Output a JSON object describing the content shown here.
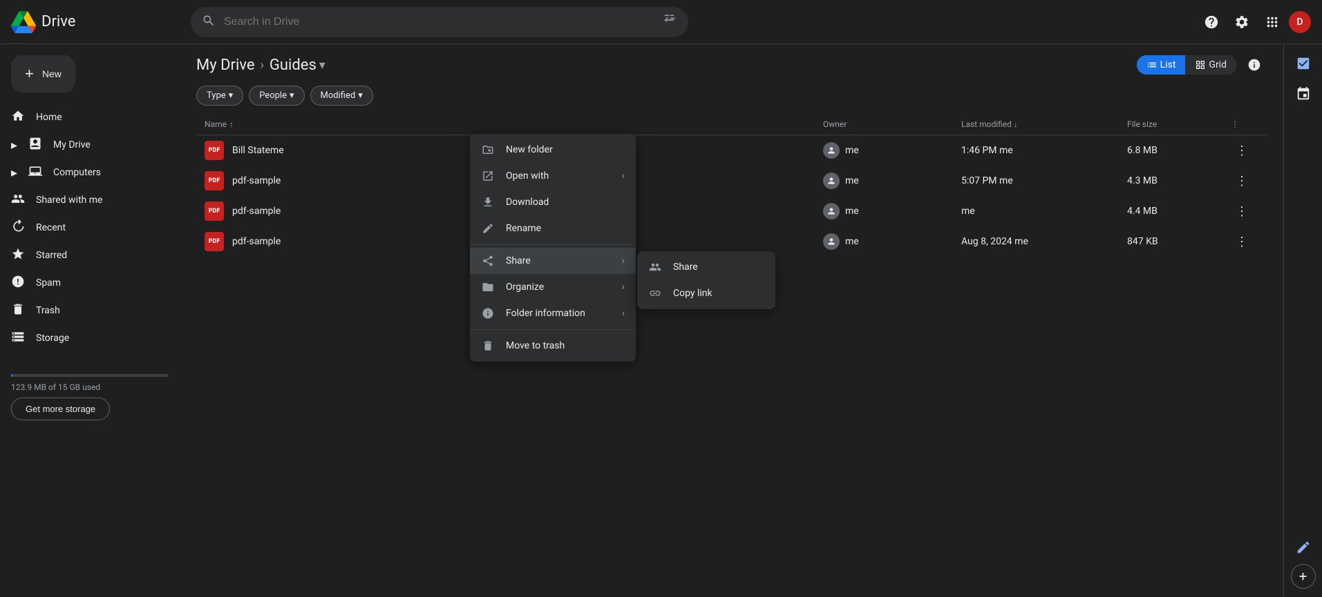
{
  "app": {
    "name": "Drive",
    "logo_alt": "Google Drive"
  },
  "topbar": {
    "search_placeholder": "Search in Drive",
    "help_icon": "?",
    "settings_icon": "⚙",
    "apps_icon": "⠿",
    "avatar_initial": "D"
  },
  "sidebar": {
    "new_button_label": "New",
    "items": [
      {
        "id": "home",
        "label": "Home",
        "icon": "🏠",
        "active": false
      },
      {
        "id": "my-drive",
        "label": "My Drive",
        "icon": "📁",
        "active": false,
        "expandable": true
      },
      {
        "id": "computers",
        "label": "Computers",
        "icon": "💻",
        "active": false,
        "expandable": true
      },
      {
        "id": "shared-with-me",
        "label": "Shared with me",
        "icon": "👥",
        "active": false
      },
      {
        "id": "recent",
        "label": "Recent",
        "icon": "🕐",
        "active": false
      },
      {
        "id": "starred",
        "label": "Starred",
        "icon": "⭐",
        "active": false
      },
      {
        "id": "spam",
        "label": "Spam",
        "icon": "🚫",
        "active": false
      },
      {
        "id": "trash",
        "label": "Trash",
        "icon": "🗑",
        "active": false
      },
      {
        "id": "storage",
        "label": "Storage",
        "icon": "☁",
        "active": false
      }
    ],
    "storage_used": "123.9 MB of 15 GB used",
    "get_storage_label": "Get more storage"
  },
  "breadcrumb": {
    "parent": "My Drive",
    "current": "Guides",
    "chevron_down": "▾"
  },
  "filters": {
    "type_label": "Type",
    "people_label": "People",
    "modified_label": "Modified",
    "chevron": "▾"
  },
  "table": {
    "columns": {
      "name": "Name",
      "owner": "Owner",
      "last_modified": "Last modified",
      "file_size": "File size"
    },
    "sort_icon": "↑",
    "sort_active": "last_modified",
    "rows": [
      {
        "id": "row1",
        "name": "Bill Stateme",
        "owner": "me",
        "modified_time": "1:46 PM",
        "modified_by": "me",
        "size": "6.8 MB",
        "type": "pdf"
      },
      {
        "id": "row2",
        "name": "pdf-sample",
        "owner": "me",
        "modified_time": "5:07 PM",
        "modified_by": "me",
        "size": "4.3 MB",
        "type": "pdf"
      },
      {
        "id": "row3",
        "name": "pdf-sample",
        "owner": "me",
        "modified_time": "",
        "modified_by": "me",
        "size": "4.4 MB",
        "type": "pdf"
      },
      {
        "id": "row4",
        "name": "pdf-sample",
        "owner": "me",
        "modified_time": "Aug 8, 2024",
        "modified_by": "me",
        "size": "847 KB",
        "type": "pdf"
      }
    ]
  },
  "context_menu": {
    "items": [
      {
        "id": "new-folder",
        "label": "New folder",
        "icon": "📁",
        "has_submenu": false
      },
      {
        "id": "open-with",
        "label": "Open with",
        "icon": "↗",
        "has_submenu": true
      },
      {
        "id": "download",
        "label": "Download",
        "icon": "⬇",
        "has_submenu": false
      },
      {
        "id": "rename",
        "label": "Rename",
        "icon": "✏",
        "has_submenu": false
      },
      {
        "id": "share",
        "label": "Share",
        "icon": "👤+",
        "has_submenu": true,
        "active": true
      },
      {
        "id": "organize",
        "label": "Organize",
        "icon": "📂",
        "has_submenu": true
      },
      {
        "id": "folder-information",
        "label": "Folder information",
        "icon": "ℹ",
        "has_submenu": true
      },
      {
        "id": "move-to-trash",
        "label": "Move to trash",
        "icon": "🗑",
        "has_submenu": false
      }
    ]
  },
  "sub_menu_share": {
    "items": [
      {
        "id": "share",
        "label": "Share",
        "icon": "👤+"
      },
      {
        "id": "copy-link",
        "label": "Copy link",
        "icon": "🔗"
      }
    ]
  },
  "view": {
    "list_label": "List",
    "grid_label": "Grid",
    "active": "list"
  },
  "right_sidebar": {
    "icons": [
      {
        "id": "tasks",
        "icon": "✓",
        "active": true
      },
      {
        "id": "calendar",
        "icon": "📅",
        "active": false
      },
      {
        "id": "edit",
        "icon": "✏",
        "active": true
      }
    ]
  }
}
